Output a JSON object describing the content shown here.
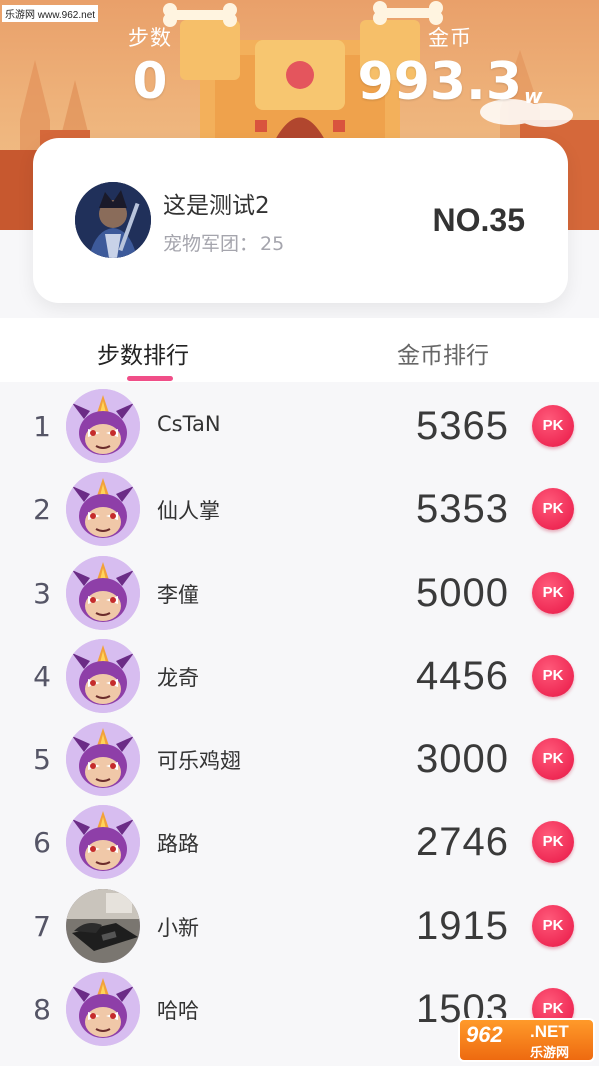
{
  "watermark": {
    "top": "乐游网 www.962.net",
    "bottom_num": "962",
    "bottom_net": ".NET",
    "bottom_cn": "乐游网"
  },
  "header": {
    "steps_label": "步数",
    "steps_value": "0",
    "coins_label": "金币",
    "coins_value": "993.3",
    "coins_unit": "w"
  },
  "profile": {
    "name": "这是测试2",
    "team_label": "宠物军团：",
    "team_value": "25",
    "rank": "NO.35"
  },
  "tabs": [
    {
      "label": "步数排行",
      "active": true
    },
    {
      "label": "金币排行",
      "active": false
    }
  ],
  "ranking": [
    {
      "rank": "1",
      "name": "CsTaN",
      "steps": "5365",
      "avatar": "devil-avatar",
      "pk": "PK"
    },
    {
      "rank": "2",
      "name": "仙人掌",
      "steps": "5353",
      "avatar": "devil-avatar",
      "pk": "PK"
    },
    {
      "rank": "3",
      "name": "李僮",
      "steps": "5000",
      "avatar": "devil-avatar",
      "pk": "PK"
    },
    {
      "rank": "4",
      "name": "龙奇",
      "steps": "4456",
      "avatar": "devil-avatar",
      "pk": "PK"
    },
    {
      "rank": "5",
      "name": "可乐鸡翅",
      "steps": "3000",
      "avatar": "devil-avatar",
      "pk": "PK"
    },
    {
      "rank": "6",
      "name": "路路",
      "steps": "2746",
      "avatar": "devil-avatar",
      "pk": "PK"
    },
    {
      "rank": "7",
      "name": "小新",
      "steps": "1915",
      "avatar": "phone-photo-avatar",
      "pk": "PK"
    },
    {
      "rank": "8",
      "name": "哈哈",
      "steps": "1503",
      "avatar": "devil-avatar",
      "pk": "PK"
    }
  ],
  "colors": {
    "accent": "#f04e88",
    "pk": "#ef2a55",
    "header_bg": "#eeb27a"
  }
}
